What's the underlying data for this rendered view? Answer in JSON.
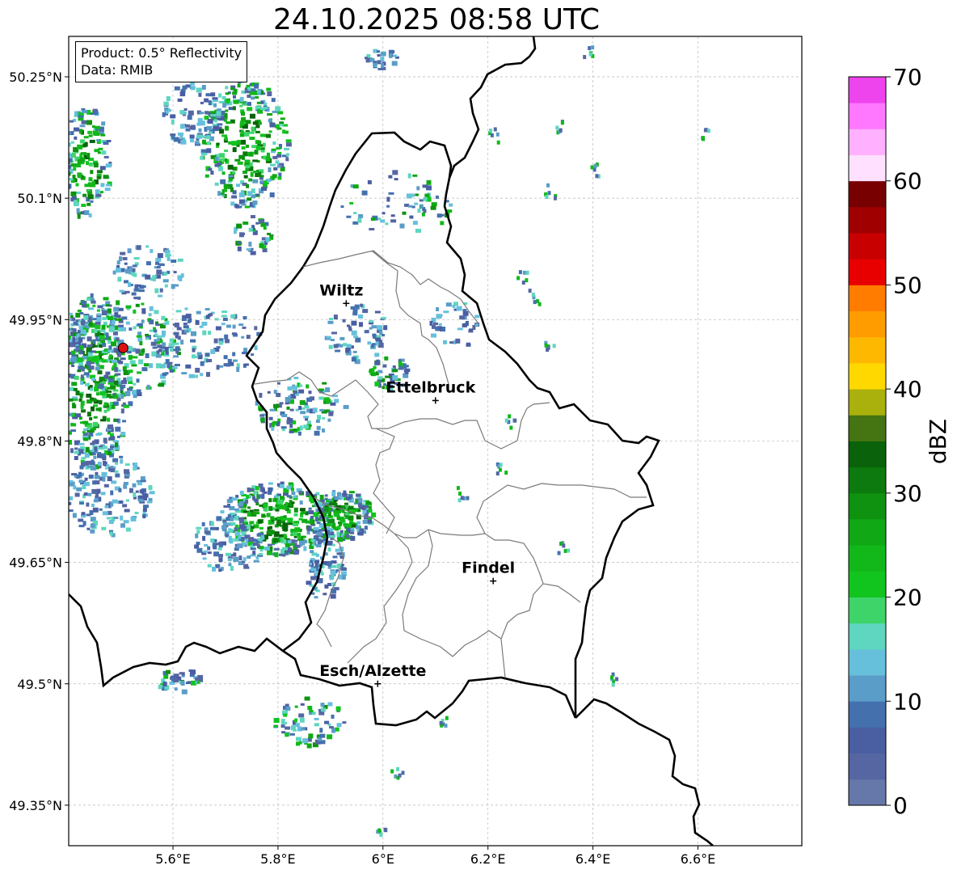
{
  "title": "24.10.2025 08:58 UTC",
  "info_box": {
    "product": "Product: 0.5° Reflectivity",
    "data": "Data: RMIB"
  },
  "map": {
    "lon_range": [
      5.4,
      6.8
    ],
    "lat_range": [
      49.3,
      50.3
    ],
    "x_ticks": [
      {
        "value": 5.6,
        "label": "5.6°E"
      },
      {
        "value": 5.8,
        "label": "5.8°E"
      },
      {
        "value": 6.0,
        "label": "6°E"
      },
      {
        "value": 6.2,
        "label": "6.2°E"
      },
      {
        "value": 6.4,
        "label": "6.4°E"
      },
      {
        "value": 6.6,
        "label": "6.6°E"
      }
    ],
    "y_ticks": [
      {
        "value": 50.25,
        "label": "50.25°N"
      },
      {
        "value": 50.1,
        "label": "50.1°N"
      },
      {
        "value": 49.95,
        "label": "49.95°N"
      },
      {
        "value": 49.8,
        "label": "49.8°N"
      },
      {
        "value": 49.65,
        "label": "49.65°N"
      },
      {
        "value": 49.5,
        "label": "49.5°N"
      },
      {
        "value": 49.35,
        "label": "49.35°N"
      }
    ],
    "grid": true,
    "cities": [
      {
        "name": "Wiltz",
        "lon": 5.93,
        "lat": 49.97
      },
      {
        "name": "Ettelbruck",
        "lon": 6.1,
        "lat": 49.85
      },
      {
        "name": "Findel",
        "lon": 6.21,
        "lat": 49.627
      },
      {
        "name": "Esch/Alzette",
        "lon": 5.99,
        "lat": 49.5
      }
    ],
    "radar_site": {
      "lon": 5.505,
      "lat": 49.915,
      "color": "#dd1111"
    }
  },
  "colorbar": {
    "label": "dBZ",
    "min": 0,
    "max": 70,
    "ticks": [
      "0",
      "10",
      "20",
      "30",
      "40",
      "50",
      "60",
      "70"
    ],
    "colors": [
      "#6677aa",
      "#5566a2",
      "#4a5ea2",
      "#4470ae",
      "#5a9dc8",
      "#66c0dc",
      "#5ed6c0",
      "#3ed46a",
      "#12c41e",
      "#12b81a",
      "#10a814",
      "#0e9210",
      "#0c7a0e",
      "#0a620a",
      "#457512",
      "#aab00c",
      "#ffd800",
      "#ffb800",
      "#ff9c00",
      "#ff7c00",
      "#e80000",
      "#c80000",
      "#a00000",
      "#780000",
      "#ffe0ff",
      "#ffb0ff",
      "#ff78ff",
      "#ee44ee"
    ]
  }
}
